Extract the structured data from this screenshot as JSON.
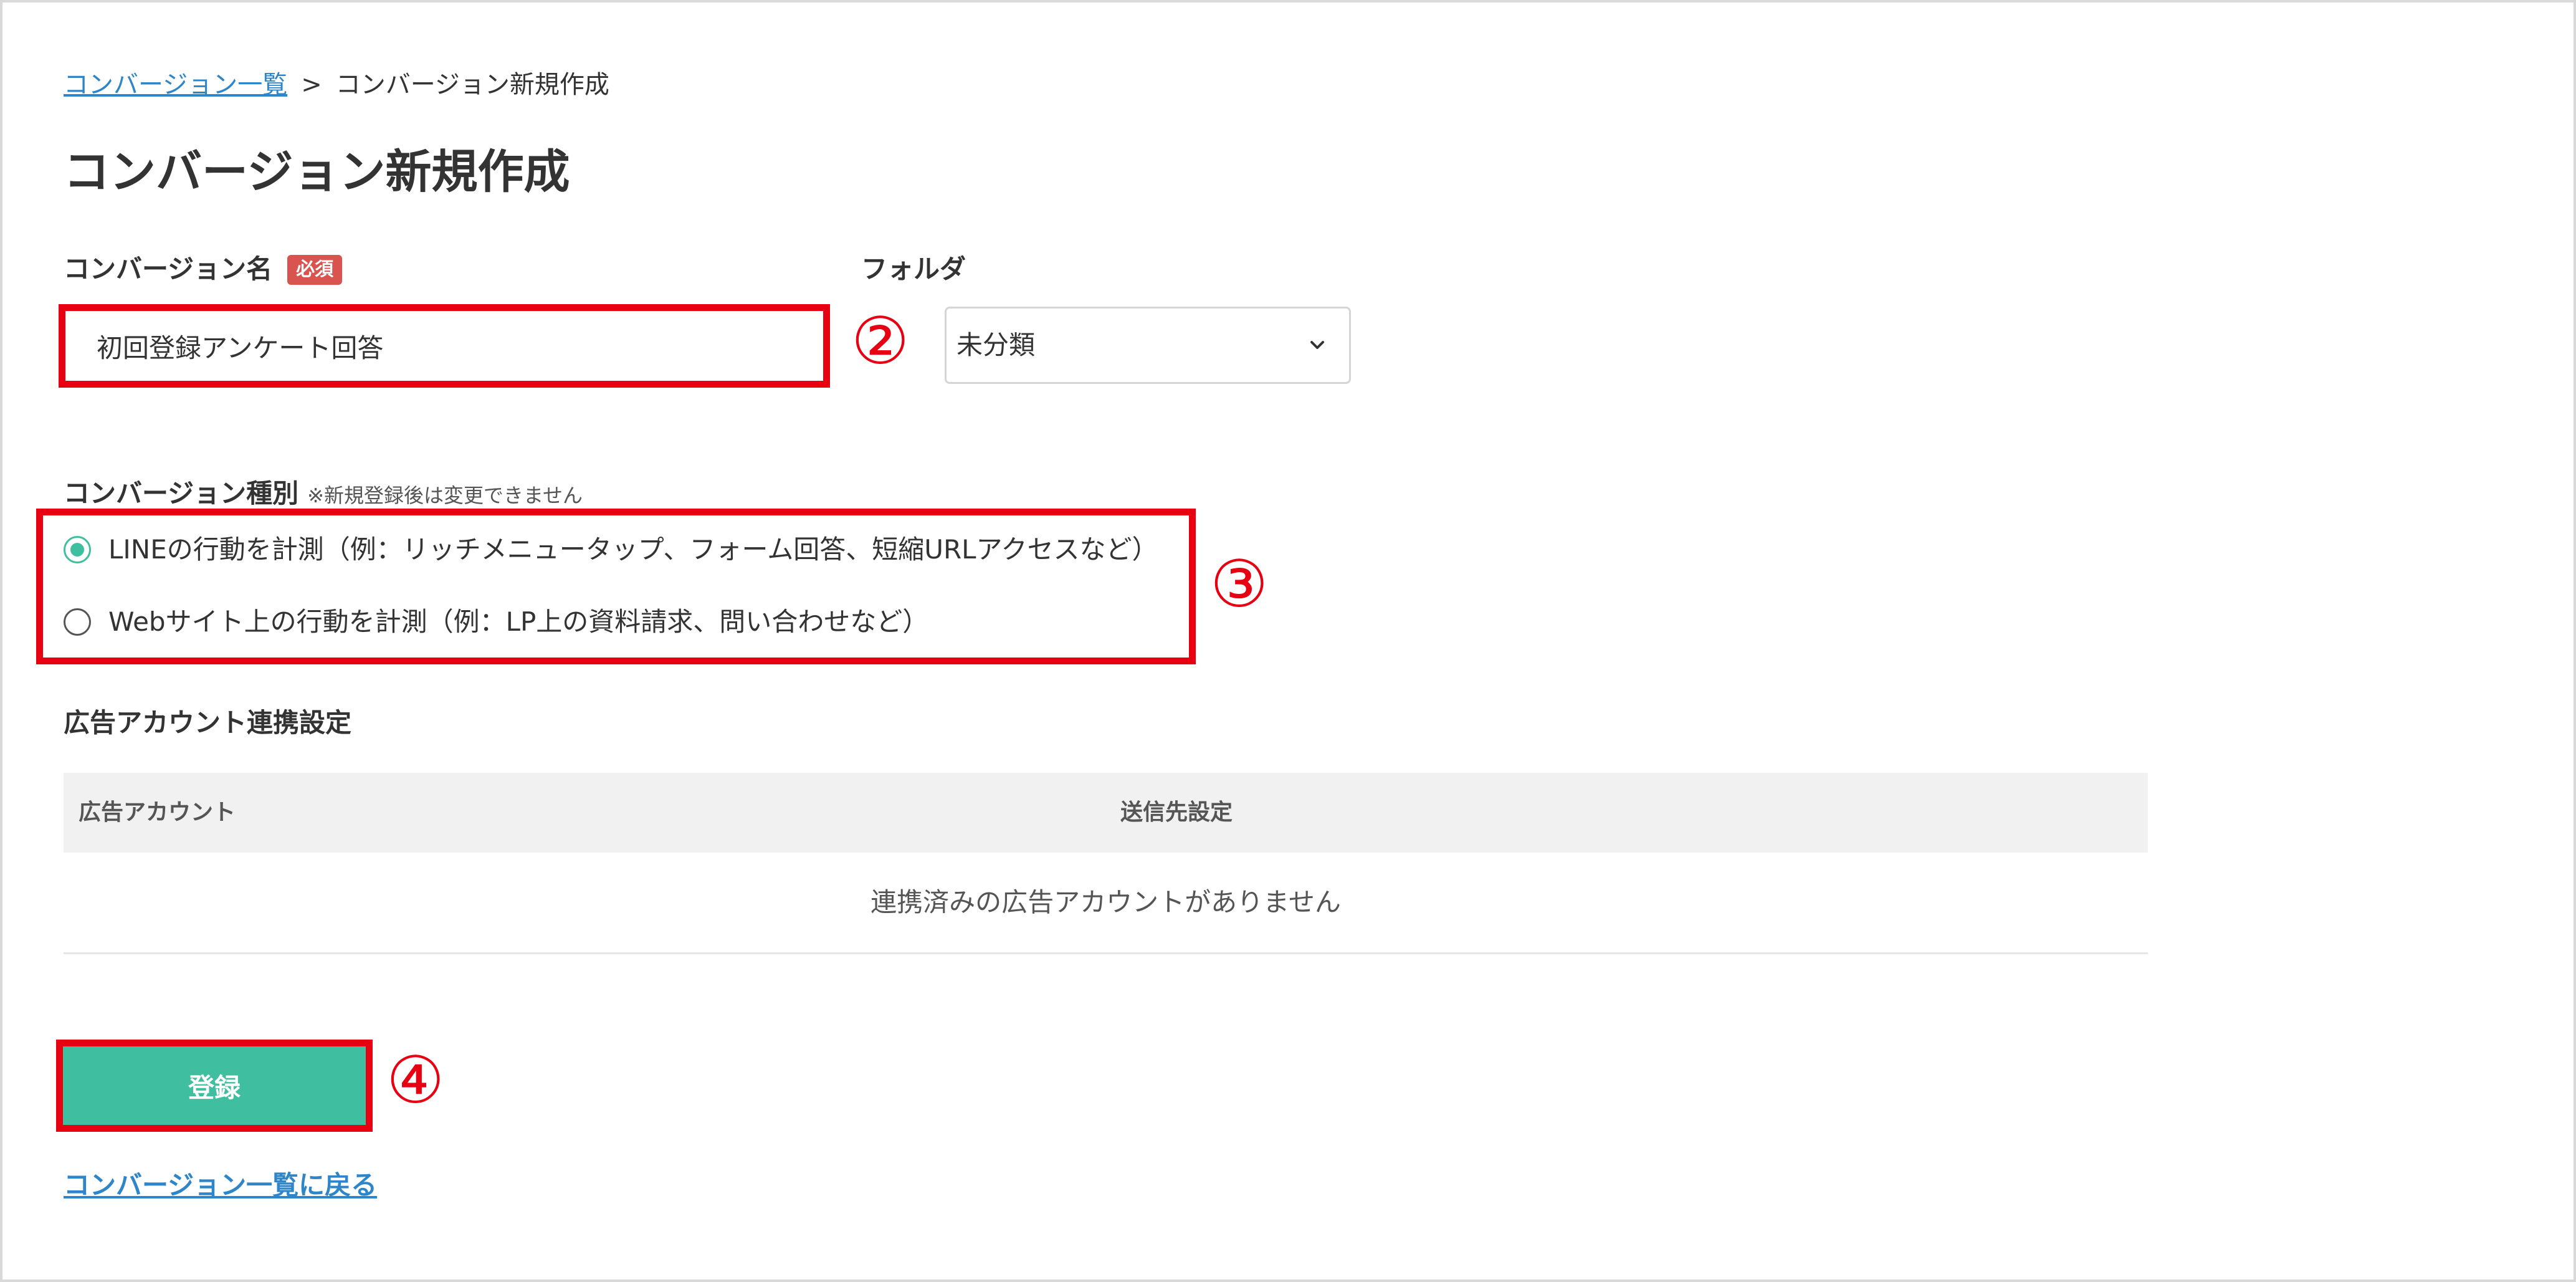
{
  "breadcrumb": {
    "link": "コンバージョン一覧",
    "separator": ">",
    "current": "コンバージョン新規作成"
  },
  "page_title": "コンバージョン新規作成",
  "form": {
    "name_label": "コンバージョン名",
    "required_badge": "必須",
    "name_value": "初回登録アンケート回答",
    "folder_label": "フォルダ",
    "folder_value": "未分類",
    "type_label": "コンバージョン種別",
    "type_note": "※新規登録後は変更できません",
    "type_options": [
      {
        "label": "LINEの行動を計測（例：リッチメニュータップ、フォーム回答、短縮URLアクセスなど）",
        "selected": true
      },
      {
        "label": "Webサイト上の行動を計測（例：LP上の資料請求、問い合わせなど）",
        "selected": false
      }
    ]
  },
  "ad_section": {
    "title": "広告アカウント連携設定",
    "columns": [
      "広告アカウント",
      "送信先設定"
    ],
    "empty_text": "連携済みの広告アカウントがありません"
  },
  "submit_label": "登録",
  "back_link": "コンバージョン一覧に戻る",
  "annotations": {
    "two": "②",
    "three": "③",
    "four": "④"
  },
  "colors": {
    "accent": "#40bfa0",
    "link": "#2e86c8",
    "highlight": "#e60012",
    "badge": "#d9534f"
  }
}
